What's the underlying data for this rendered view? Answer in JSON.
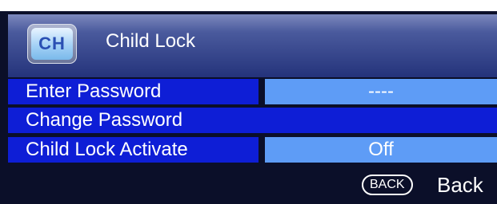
{
  "header": {
    "icon": "ch-icon",
    "icon_text": "CH",
    "title": "Child Lock"
  },
  "menu": {
    "items": [
      {
        "label": "Enter Password",
        "value": "----"
      },
      {
        "label": "Change Password"
      },
      {
        "label": "Child Lock Activate",
        "value": "Off"
      }
    ]
  },
  "footer": {
    "back_key": "BACK",
    "back_label": "Back"
  },
  "colors": {
    "background": "#0b0f29",
    "row_label_bg": "#0e1ed6",
    "row_value_bg": "#5e9cf6",
    "text": "#ffffff"
  }
}
